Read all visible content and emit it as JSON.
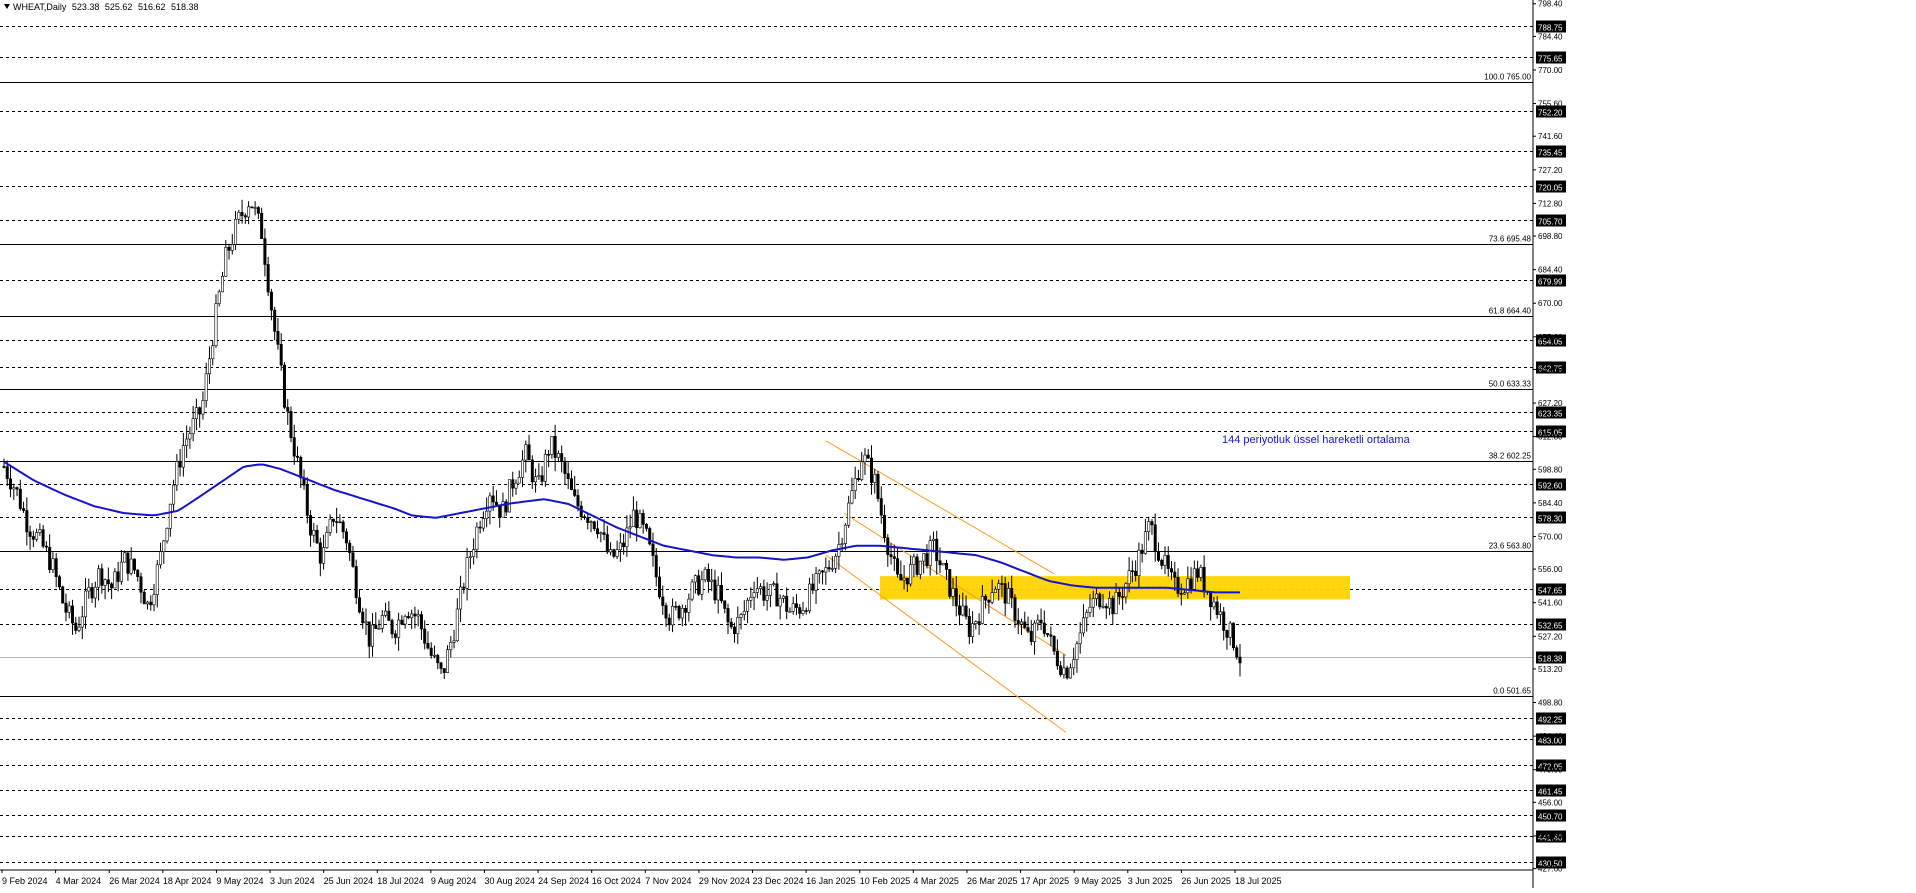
{
  "header": {
    "symbol": "WHEAT,Daily",
    "open": "523.38",
    "high": "525.62",
    "low": "516.62",
    "close": "518.38"
  },
  "colors": {
    "candle": "#000000",
    "ema": "#1414c8",
    "channel": "#ff9a1f",
    "zone": "#ffd400",
    "annotation": "#1414c8",
    "grid_dashed": "#000000",
    "fib": "#000000",
    "price_line": "#b4b4b4"
  },
  "chart_data": {
    "type": "candlestick",
    "title": "WHEAT,Daily",
    "ylim": [
      427.0,
      800.0
    ],
    "y_ticks": [
      "798.40",
      "784.40",
      "770.00",
      "755.60",
      "741.60",
      "727.20",
      "712.80",
      "698.80",
      "684.40",
      "670.00",
      "655.60",
      "641.60",
      "627.20",
      "612.80",
      "598.80",
      "584.40",
      "570.00",
      "556.00",
      "541.60",
      "527.20",
      "513.20",
      "498.80",
      "484.40",
      "470.00",
      "456.00",
      "441.60",
      "427.60"
    ],
    "x_labels": [
      "9 Feb 2024",
      "4 Mar 2024",
      "26 Mar 2024",
      "18 Apr 2024",
      "9 May 2024",
      "3 Jun 2024",
      "25 Jun 2024",
      "18 Jul 2024",
      "9 Aug 2024",
      "30 Aug 2024",
      "24 Sep 2024",
      "16 Oct 2024",
      "7 Nov 2024",
      "29 Nov 2024",
      "23 Dec 2024",
      "16 Jan 2025",
      "10 Feb 2025",
      "4 Mar 2025",
      "26 Mar 2025",
      "17 Apr 2025",
      "9 May 2025",
      "3 Jun 2025",
      "26 Jun 2025",
      "18 Jul 2025"
    ],
    "level_lines": [
      {
        "label": "788.75",
        "value": 788.75
      },
      {
        "label": "775.65",
        "value": 775.65
      },
      {
        "label": "752.20",
        "value": 752.2
      },
      {
        "label": "735.45",
        "value": 735.45
      },
      {
        "label": "720.05",
        "value": 720.05
      },
      {
        "label": "705.70",
        "value": 705.7
      },
      {
        "label": "679.99",
        "value": 679.99
      },
      {
        "label": "654.05",
        "value": 654.05
      },
      {
        "label": "642.75",
        "value": 642.75
      },
      {
        "label": "623.35",
        "value": 623.35
      },
      {
        "label": "615.05",
        "value": 615.05
      },
      {
        "label": "592.60",
        "value": 592.6
      },
      {
        "label": "578.30",
        "value": 578.3
      },
      {
        "label": "547.65",
        "value": 547.65
      },
      {
        "label": "532.65",
        "value": 532.65
      },
      {
        "label": "492.25",
        "value": 492.25
      },
      {
        "label": "483.00",
        "value": 483.0
      },
      {
        "label": "472.05",
        "value": 472.05
      },
      {
        "label": "461.45",
        "value": 461.45
      },
      {
        "label": "450.70",
        "value": 450.7
      },
      {
        "label": "441.40",
        "value": 441.4
      },
      {
        "label": "430.50",
        "value": 430.5
      }
    ],
    "fib_levels": [
      {
        "label": "100.0 765.00",
        "value": 765.0
      },
      {
        "label": "73.6 695.48",
        "value": 695.48
      },
      {
        "label": "61.8 664.40",
        "value": 664.4
      },
      {
        "label": "50.0 633.33",
        "value": 633.33
      },
      {
        "label": "38.2 602.25",
        "value": 602.25
      },
      {
        "label": "23.6 563.80",
        "value": 563.8
      },
      {
        "label": "0.0 501.65",
        "value": 501.65
      }
    ],
    "current_price": {
      "label": "518.38",
      "value": 518.38
    },
    "ema_label": "144 periyotluk üssel hareketli ortalama",
    "ema_anchors": [
      [
        0,
        602
      ],
      [
        0.05,
        594
      ],
      [
        0.1,
        588
      ],
      [
        0.15,
        583
      ],
      [
        0.2,
        580
      ],
      [
        0.25,
        579
      ],
      [
        0.29,
        581
      ],
      [
        0.32,
        586
      ],
      [
        0.36,
        593
      ],
      [
        0.4,
        600
      ],
      [
        0.43,
        601
      ],
      [
        0.46,
        599
      ],
      [
        0.5,
        595
      ],
      [
        0.55,
        590
      ],
      [
        0.6,
        586
      ],
      [
        0.65,
        582
      ],
      [
        0.68,
        579
      ],
      [
        0.72,
        578
      ],
      [
        0.76,
        580
      ],
      [
        0.8,
        582
      ],
      [
        0.84,
        584
      ],
      [
        0.87,
        585
      ],
      [
        0.9,
        586
      ],
      [
        0.94,
        584
      ],
      [
        0.98,
        579
      ],
      [
        1.02,
        574
      ],
      [
        1.06,
        570
      ],
      [
        1.1,
        566
      ],
      [
        1.14,
        564
      ],
      [
        1.18,
        562
      ],
      [
        1.22,
        561
      ],
      [
        1.26,
        561
      ],
      [
        1.3,
        560
      ],
      [
        1.34,
        561
      ],
      [
        1.38,
        564
      ],
      [
        1.42,
        566
      ],
      [
        1.46,
        566
      ],
      [
        1.5,
        565
      ],
      [
        1.54,
        564
      ],
      [
        1.58,
        563
      ],
      [
        1.62,
        562
      ],
      [
        1.66,
        559
      ],
      [
        1.7,
        555
      ],
      [
        1.74,
        551
      ],
      [
        1.78,
        549
      ],
      [
        1.82,
        548
      ],
      [
        1.86,
        548
      ],
      [
        1.9,
        548
      ],
      [
        1.94,
        548
      ],
      [
        1.98,
        547
      ],
      [
        2.02,
        546
      ],
      [
        2.06,
        546
      ]
    ],
    "price_anchors": [
      [
        0,
        600
      ],
      [
        0.02,
        590
      ],
      [
        0.04,
        575
      ],
      [
        0.06,
        568
      ],
      [
        0.08,
        558
      ],
      [
        0.1,
        540
      ],
      [
        0.12,
        530
      ],
      [
        0.14,
        545
      ],
      [
        0.16,
        555
      ],
      [
        0.18,
        548
      ],
      [
        0.2,
        560
      ],
      [
        0.22,
        555
      ],
      [
        0.24,
        540
      ],
      [
        0.26,
        560
      ],
      [
        0.28,
        590
      ],
      [
        0.3,
        610
      ],
      [
        0.33,
        625
      ],
      [
        0.35,
        660
      ],
      [
        0.37,
        690
      ],
      [
        0.39,
        705
      ],
      [
        0.41,
        715
      ],
      [
        0.43,
        700
      ],
      [
        0.45,
        660
      ],
      [
        0.47,
        625
      ],
      [
        0.49,
        600
      ],
      [
        0.51,
        575
      ],
      [
        0.53,
        560
      ],
      [
        0.55,
        580
      ],
      [
        0.57,
        570
      ],
      [
        0.59,
        545
      ],
      [
        0.61,
        525
      ],
      [
        0.63,
        535
      ],
      [
        0.65,
        530
      ],
      [
        0.67,
        540
      ],
      [
        0.69,
        535
      ],
      [
        0.71,
        520
      ],
      [
        0.73,
        510
      ],
      [
        0.75,
        530
      ],
      [
        0.77,
        555
      ],
      [
        0.79,
        575
      ],
      [
        0.81,
        590
      ],
      [
        0.83,
        580
      ],
      [
        0.85,
        595
      ],
      [
        0.87,
        605
      ],
      [
        0.89,
        590
      ],
      [
        0.91,
        610
      ],
      [
        0.93,
        600
      ],
      [
        0.95,
        585
      ],
      [
        0.97,
        580
      ],
      [
        0.99,
        575
      ],
      [
        1.01,
        560
      ],
      [
        1.03,
        565
      ],
      [
        1.05,
        580
      ],
      [
        1.07,
        570
      ],
      [
        1.09,
        550
      ],
      [
        1.11,
        535
      ],
      [
        1.13,
        540
      ],
      [
        1.15,
        548
      ],
      [
        1.17,
        552
      ],
      [
        1.19,
        545
      ],
      [
        1.21,
        530
      ],
      [
        1.23,
        535
      ],
      [
        1.25,
        550
      ],
      [
        1.27,
        545
      ],
      [
        1.29,
        545
      ],
      [
        1.31,
        538
      ],
      [
        1.33,
        540
      ],
      [
        1.35,
        548
      ],
      [
        1.37,
        555
      ],
      [
        1.39,
        565
      ],
      [
        1.41,
        585
      ],
      [
        1.43,
        605
      ],
      [
        1.45,
        595
      ],
      [
        1.47,
        570
      ],
      [
        1.49,
        550
      ],
      [
        1.51,
        555
      ],
      [
        1.53,
        560
      ],
      [
        1.55,
        565
      ],
      [
        1.57,
        552
      ],
      [
        1.59,
        540
      ],
      [
        1.61,
        530
      ],
      [
        1.63,
        540
      ],
      [
        1.65,
        550
      ],
      [
        1.67,
        545
      ],
      [
        1.69,
        535
      ],
      [
        1.71,
        525
      ],
      [
        1.73,
        535
      ],
      [
        1.75,
        520
      ],
      [
        1.77,
        512
      ],
      [
        1.79,
        525
      ],
      [
        1.81,
        540
      ],
      [
        1.83,
        545
      ],
      [
        1.85,
        540
      ],
      [
        1.87,
        550
      ],
      [
        1.89,
        560
      ],
      [
        1.91,
        575
      ],
      [
        1.93,
        560
      ],
      [
        1.95,
        548
      ],
      [
        1.97,
        550
      ],
      [
        1.99,
        555
      ],
      [
        2.01,
        545
      ],
      [
        2.03,
        535
      ],
      [
        2.05,
        525
      ],
      [
        2.06,
        518
      ]
    ]
  }
}
